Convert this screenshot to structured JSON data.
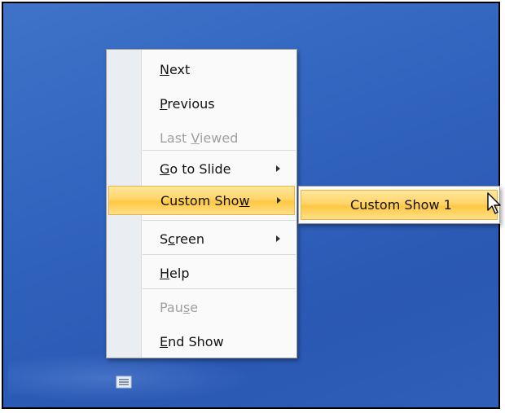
{
  "menu": {
    "items": [
      {
        "pre": "",
        "key": "N",
        "post": "ext",
        "disabled": false,
        "submenu": false
      },
      {
        "pre": "",
        "key": "P",
        "post": "revious",
        "disabled": false,
        "submenu": false
      },
      {
        "pre": "Last ",
        "key": "V",
        "post": "iewed",
        "disabled": true,
        "submenu": false
      },
      {
        "pre": "",
        "key": "G",
        "post": "o to Slide",
        "disabled": false,
        "submenu": true
      },
      {
        "pre": "Custom Sho",
        "key": "w",
        "post": "",
        "disabled": false,
        "submenu": true,
        "highlighted": true
      },
      {
        "pre": "S",
        "key": "c",
        "post": "reen",
        "disabled": false,
        "submenu": true
      },
      {
        "pre": "",
        "key": "H",
        "post": "elp",
        "disabled": false,
        "submenu": false
      },
      {
        "pre": "Pau",
        "key": "s",
        "post": "e",
        "disabled": true,
        "submenu": false
      },
      {
        "pre": "",
        "key": "E",
        "post": "nd Show",
        "disabled": false,
        "submenu": false
      }
    ]
  },
  "submenu": {
    "items": [
      {
        "label": "Custom Show 1",
        "highlighted": true
      }
    ]
  },
  "icons": {
    "cursor": "arrow-cursor-icon",
    "menu_button": "slide-menu-icon",
    "submenu_arrow": "submenu-arrow-icon"
  },
  "colors": {
    "background": "#2f62bd",
    "highlight": "#ffd46a",
    "disabled_text": "#a0a0a0"
  }
}
